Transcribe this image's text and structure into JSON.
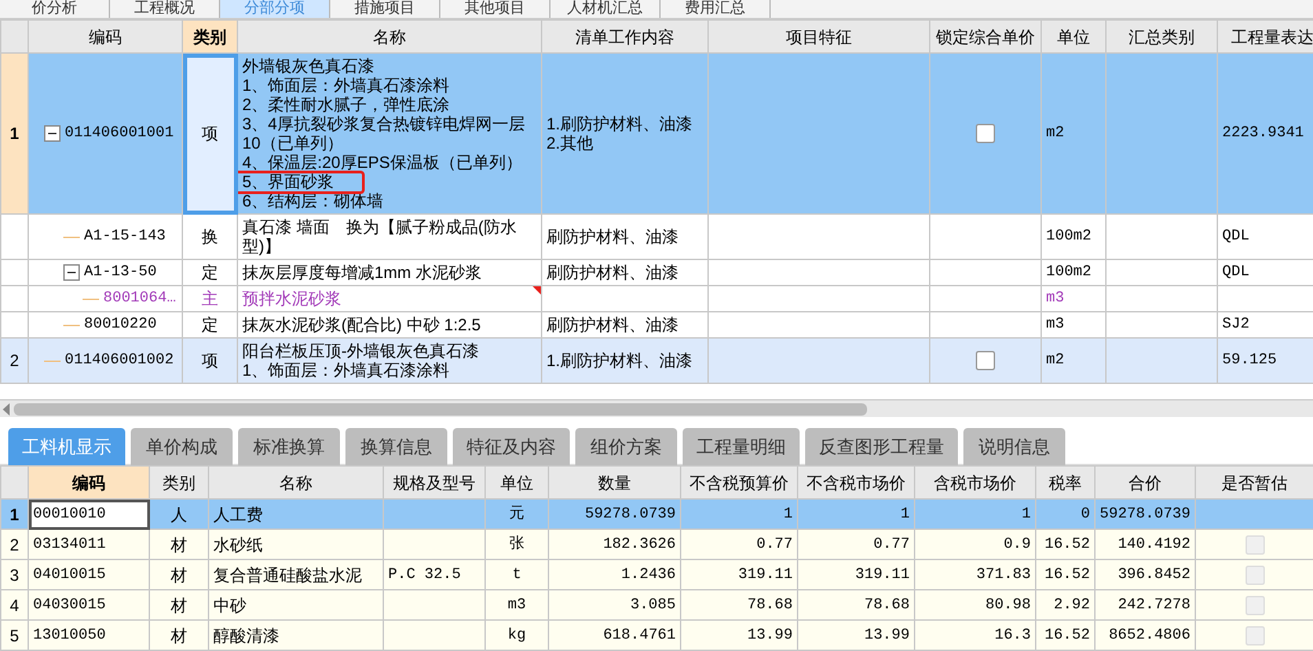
{
  "top_tabs": [
    {
      "label": "价分析",
      "selected": false
    },
    {
      "label": "工程概况",
      "selected": false
    },
    {
      "label": "分部分项",
      "selected": true
    },
    {
      "label": "措施项目",
      "selected": false
    },
    {
      "label": "其他项目",
      "selected": false
    },
    {
      "label": "人材机汇总",
      "selected": false
    },
    {
      "label": "费用汇总",
      "selected": false
    }
  ],
  "items_table": {
    "columns": [
      {
        "label": "编码",
        "selected": false
      },
      {
        "label": "类别",
        "selected": true
      },
      {
        "label": "名称",
        "selected": false
      },
      {
        "label": "清单工作内容",
        "selected": false
      },
      {
        "label": "项目特征",
        "selected": false
      },
      {
        "label": "锁定综合单价",
        "selected": false
      },
      {
        "label": "单位",
        "selected": false
      },
      {
        "label": "汇总类别",
        "selected": false
      },
      {
        "label": "工程量表达",
        "selected": false
      }
    ],
    "rows": [
      {
        "kind": "bill",
        "number": "1",
        "selected": true,
        "expanded": true,
        "code": "011406001001",
        "category": "项",
        "name_lines": [
          {
            "text": "外墙银灰色真石漆",
            "circled": false
          },
          {
            "text": "1、饰面层：外墙真石漆涂料",
            "circled": false
          },
          {
            "text": "2、柔性耐水腻子，弹性底涂",
            "circled": false
          },
          {
            "text": "3、4厚抗裂砂浆复合热镀锌电焊网一层",
            "circled": false
          },
          {
            "text": "10（已单列）",
            "circled": false
          },
          {
            "text": "4、保温层:20厚EPS保温板（已单列）",
            "circled": false
          },
          {
            "text": "5、界面砂浆",
            "circled": true
          },
          {
            "text": "6、结构层：砌体墙",
            "circled": false
          }
        ],
        "content_lines": [
          "1.刷防护材料、油漆",
          "2.其他"
        ],
        "lock": {
          "checked": false
        },
        "unit": "m2",
        "expression": "2223.9341",
        "children": [
          {
            "kind": "quota",
            "selected": false,
            "code": "A1-15-143",
            "category": "换",
            "name_lines": [
              {
                "text": "真石漆 墙面　换为【腻子粉成品(防水型)】",
                "circled": false
              }
            ],
            "content_lines": [
              "刷防护材料、油漆"
            ],
            "unit": "100m2",
            "expression": "QDL"
          },
          {
            "kind": "quota",
            "selected": false,
            "expanded": true,
            "code": "A1-13-50",
            "category": "定",
            "name_lines": [
              {
                "text": "抹灰层厚度每增减1mm 水泥砂浆",
                "circled": false
              }
            ],
            "content_lines": [
              "刷防护材料、油漆"
            ],
            "unit": "100m2",
            "expression": "QDL",
            "children": [
              {
                "kind": "main",
                "selected": false,
                "flagged": true,
                "code": "8001064…",
                "category": "主",
                "name_lines": [
                  {
                    "text": "预拌水泥砂浆",
                    "circled": false
                  }
                ],
                "unit": "m3"
              }
            ]
          },
          {
            "kind": "quota",
            "selected": false,
            "code": "80010220",
            "category": "定",
            "name_lines": [
              {
                "text": "抹灰水泥砂浆(配合比) 中砂 1:2.5",
                "circled": false
              }
            ],
            "content_lines": [
              "刷防护材料、油漆"
            ],
            "unit": "m3",
            "expression": "SJ2"
          }
        ]
      },
      {
        "kind": "bill",
        "number": "2",
        "selected": false,
        "code": "011406001002",
        "category": "项",
        "name_lines": [
          {
            "text": "阳台栏板压顶-外墙银灰色真石漆",
            "circled": false
          },
          {
            "text": "1、饰面层：外墙真石漆涂料",
            "circled": false
          }
        ],
        "content_lines": [
          "1.刷防护材料、油漆"
        ],
        "lock": {
          "checked": false
        },
        "unit": "m2",
        "expression": "59.125"
      }
    ]
  },
  "bottom_tabs": [
    {
      "label": "工料机显示",
      "selected": true
    },
    {
      "label": "单价构成",
      "selected": false
    },
    {
      "label": "标准换算",
      "selected": false
    },
    {
      "label": "换算信息",
      "selected": false
    },
    {
      "label": "特征及内容",
      "selected": false
    },
    {
      "label": "组价方案",
      "selected": false
    },
    {
      "label": "工程量明细",
      "selected": false
    },
    {
      "label": "反查图形工程量",
      "selected": false
    },
    {
      "label": "说明信息",
      "selected": false
    }
  ],
  "resources_table": {
    "columns": [
      {
        "label": "编码",
        "selected": true
      },
      {
        "label": "类别",
        "selected": false
      },
      {
        "label": "名称",
        "selected": false
      },
      {
        "label": "规格及型号",
        "selected": false
      },
      {
        "label": "单位",
        "selected": false
      },
      {
        "label": "数量",
        "selected": false
      },
      {
        "label": "不含税预算价",
        "selected": false
      },
      {
        "label": "不含税市场价",
        "selected": false
      },
      {
        "label": "含税市场价",
        "selected": false
      },
      {
        "label": "税率",
        "selected": false
      },
      {
        "label": "合价",
        "selected": false
      },
      {
        "label": "是否暂估",
        "selected": false
      }
    ],
    "rows": [
      {
        "number": "1",
        "selected": true,
        "cells": [
          "00010010",
          "人",
          "人工费",
          "",
          "元",
          "59278.0739",
          "1",
          "1",
          "1",
          "0",
          "59278.0739"
        ]
      },
      {
        "number": "2",
        "selected": false,
        "cells": [
          "03134011",
          "材",
          "水砂纸",
          "",
          "张",
          "182.3626",
          "0.77",
          "0.77",
          "0.9",
          "16.52",
          "140.4192"
        ],
        "provisional": {
          "checked": false
        }
      },
      {
        "number": "3",
        "selected": false,
        "cells": [
          "04010015",
          "材",
          "复合普通硅酸盐水泥",
          "P.C 32.5",
          "t",
          "1.2436",
          "319.11",
          "319.11",
          "371.83",
          "16.52",
          "396.8452"
        ],
        "provisional": {
          "checked": false
        }
      },
      {
        "number": "4",
        "selected": false,
        "cells": [
          "04030015",
          "材",
          "中砂",
          "",
          "m3",
          "3.085",
          "78.68",
          "78.68",
          "80.98",
          "2.92",
          "242.7278"
        ],
        "provisional": {
          "checked": false
        }
      },
      {
        "number": "5",
        "selected": false,
        "cells": [
          "13010050",
          "材",
          "醇酸清漆",
          "",
          "kg",
          "618.4761",
          "13.99",
          "13.99",
          "16.3",
          "16.52",
          "8652.4806"
        ],
        "provisional": {
          "checked": false
        }
      }
    ]
  }
}
